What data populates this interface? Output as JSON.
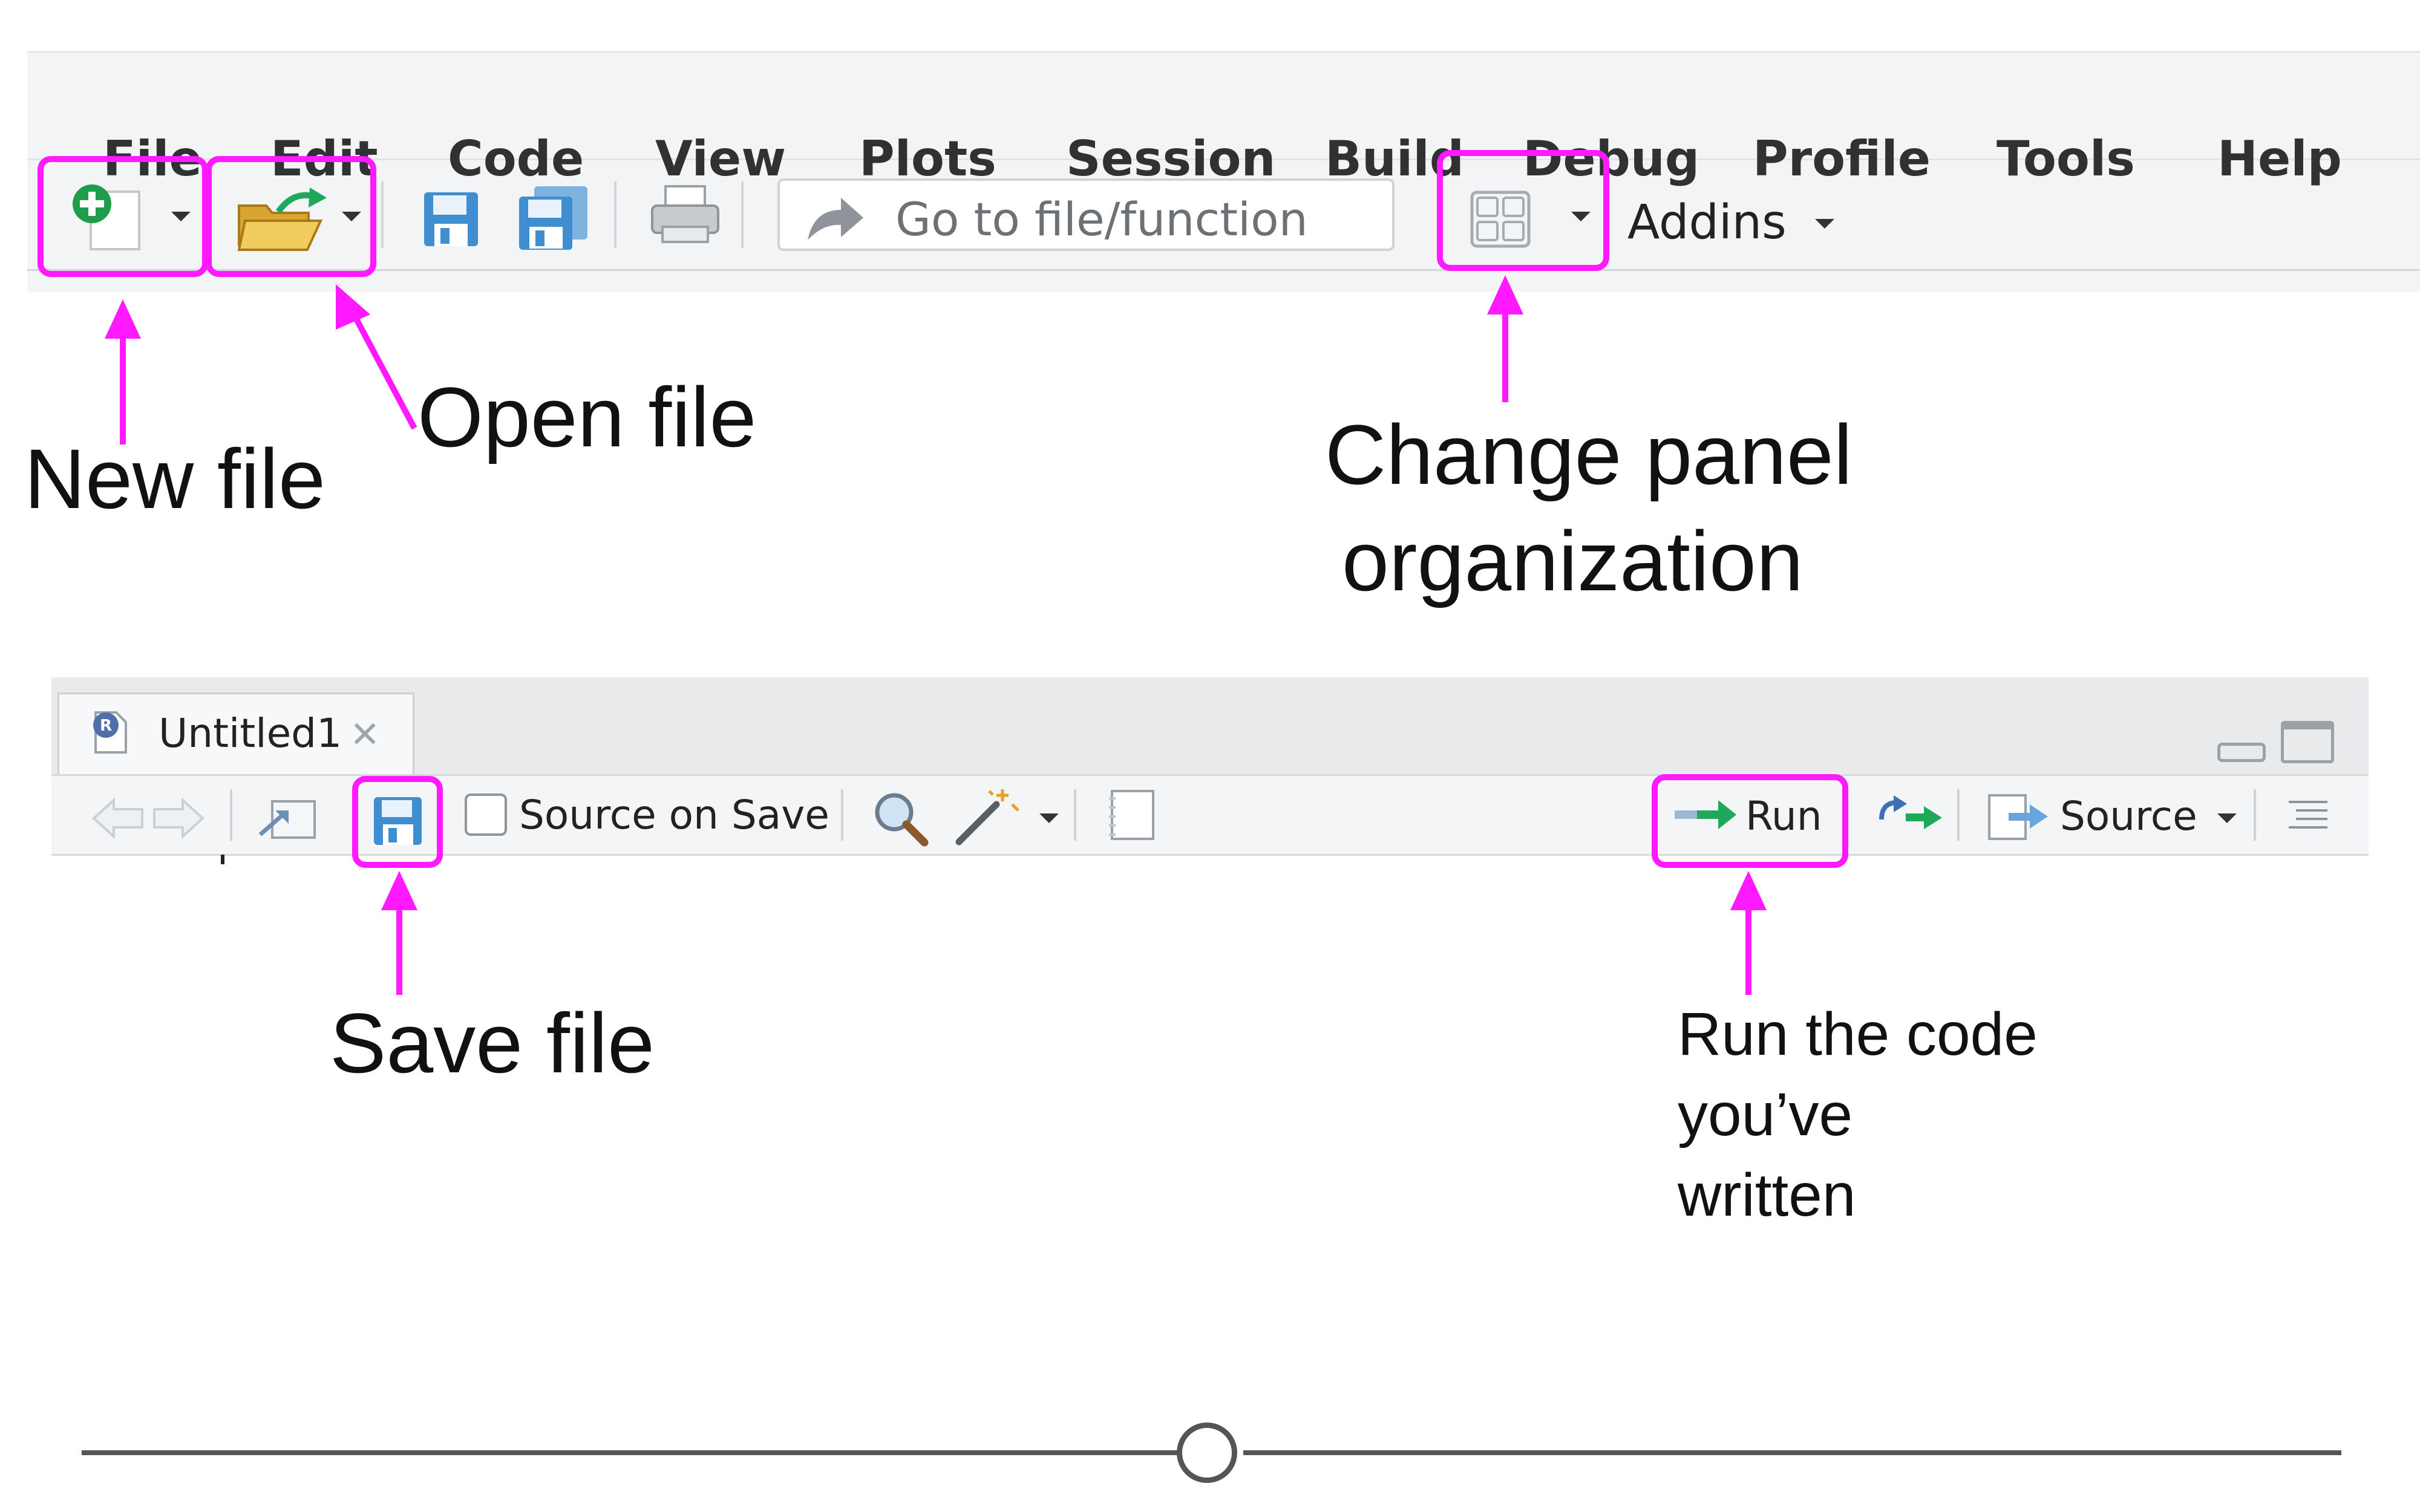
{
  "menubar": {
    "items": [
      "File",
      "Edit",
      "Code",
      "View",
      "Plots",
      "Session",
      "Build",
      "Debug",
      "Profile",
      "Tools",
      "Help"
    ]
  },
  "toolbar": {
    "goto_placeholder": "Go to file/function",
    "addins_label": "Addins"
  },
  "annotations": {
    "new_file": "New file",
    "open_file": "Open file",
    "change_panel_line1": "Change panel",
    "change_panel_line2": "organization",
    "save_file": "Save file",
    "run_line1": "Run the code",
    "run_line2": "you’ve",
    "run_line3": "written"
  },
  "editor": {
    "tab_title": "Untitled1",
    "source_on_save_label": "Source on Save",
    "run_label": "Run",
    "source_label": "Source"
  },
  "colors": {
    "highlight": "#ff19ff",
    "toolbar_bg": "#f2f4f5",
    "run_arrow": "#1fa85a",
    "save_icon": "#3f8fd0"
  }
}
